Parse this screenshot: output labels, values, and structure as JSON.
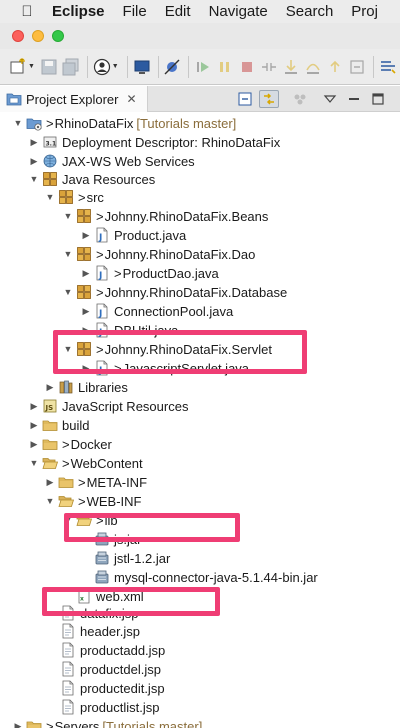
{
  "menubar": {
    "app_name": "Eclipse",
    "items": [
      "File",
      "Edit",
      "Navigate",
      "Search",
      "Proj"
    ]
  },
  "view": {
    "tab_label": "Project Explorer",
    "tab_close": "✕"
  },
  "tree": {
    "project": {
      "label": "RhinoDataFix",
      "decoration": "[Tutorials master]"
    },
    "deployment_descriptor": "Deployment Descriptor: RhinoDataFix",
    "jaxws": "JAX-WS Web Services",
    "java_resources": "Java Resources",
    "src": "src",
    "pkg_beans": "Johnny.RhinoDataFix.Beans",
    "product_java": "Product.java",
    "pkg_dao": "Johnny.RhinoDataFix.Dao",
    "productdao_java": "ProductDao.java",
    "pkg_database": "Johnny.RhinoDataFix.Database",
    "connectionpool_java": "ConnectionPool.java",
    "dbutil_java": "DBUtil.java",
    "pkg_servlet": "Johnny.RhinoDataFix.Servlet",
    "javascriptservlet_java": "JavascriptServlet.java",
    "libraries": "Libraries",
    "javascript_resources": "JavaScript Resources",
    "build": "build",
    "docker": "Docker",
    "webcontent": "WebContent",
    "meta_inf": "META-INF",
    "web_inf": "WEB-INF",
    "lib": "lib",
    "js_jar": "js.jar",
    "jstl_jar": "jstl-1.2.jar",
    "mysql_jar": "mysql-connector-java-5.1.44-bin.jar",
    "web_xml": "web.xml",
    "datafix_jsp": "datafix.jsp",
    "header_jsp": "header.jsp",
    "productadd_jsp": "productadd.jsp",
    "productdel_jsp": "productdel.jsp",
    "productedit_jsp": "productedit.jsp",
    "productlist_jsp": "productlist.jsp",
    "servers": {
      "label": "Servers",
      "decoration": "[Tutorials master]"
    }
  },
  "colors": {
    "highlight": "#ef3d74",
    "folder": "#e9c46a",
    "package": "#c8902c",
    "java_file": "#2f6ebd"
  }
}
